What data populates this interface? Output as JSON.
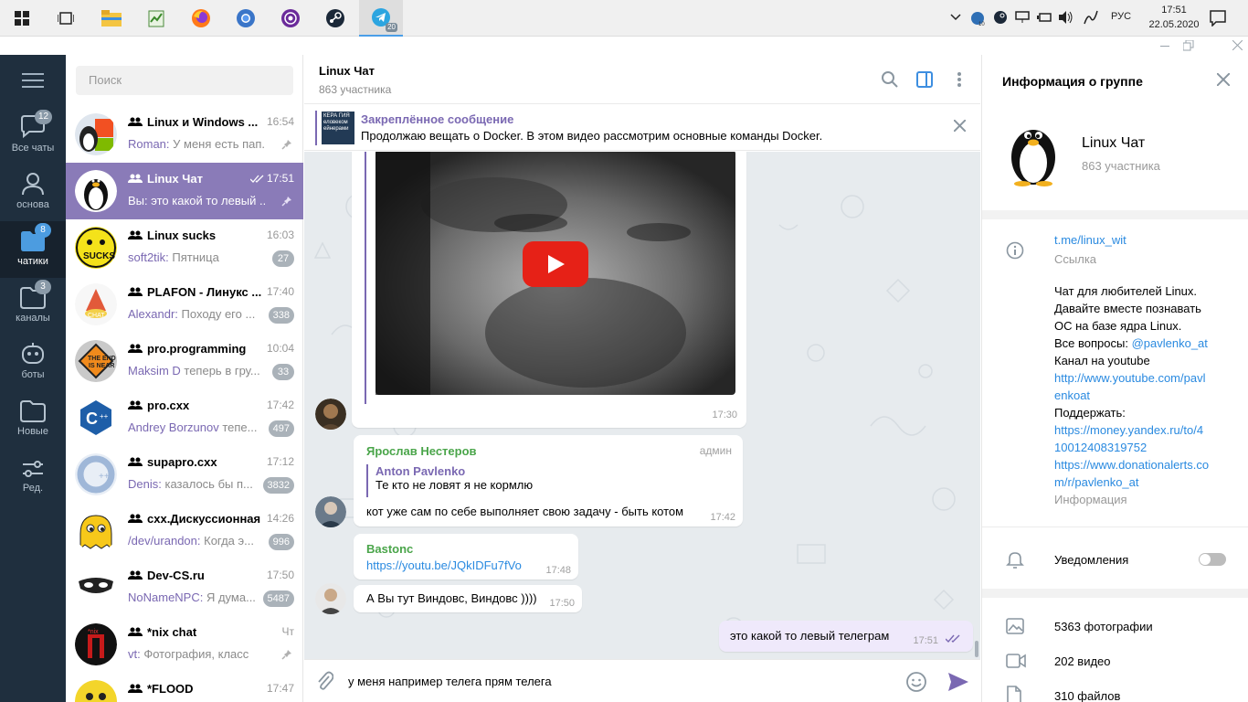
{
  "taskbar": {
    "lang": "РУС",
    "time": "17:51",
    "date": "22.05.2020",
    "telegram_badge": "20",
    "apps": [
      "windows-start",
      "task-view",
      "file-explorer",
      "notepad",
      "firefox",
      "chromium",
      "tor-browser",
      "steam",
      "telegram"
    ]
  },
  "rail": {
    "items": [
      {
        "label": "Все чаты",
        "badge": "12"
      },
      {
        "label": "основа",
        "badge": ""
      },
      {
        "label": "чатики",
        "badge": "8"
      },
      {
        "label": "каналы",
        "badge": "3"
      },
      {
        "label": "боты",
        "badge": ""
      },
      {
        "label": "Новые",
        "badge": ""
      },
      {
        "label": "Ред.",
        "badge": ""
      }
    ]
  },
  "chatlist": {
    "search_placeholder": "Поиск",
    "chats": [
      {
        "name": "Linux и Windows ...",
        "time": "16:54",
        "sender": "Roman:",
        "preview": " У меня есть пап...",
        "count": "",
        "pinned": true
      },
      {
        "name": "Linux Чат",
        "time": "17:51",
        "sender": "Вы:",
        "preview": " это какой то левый ...",
        "count": "",
        "pinned": true
      },
      {
        "name": "Linux sucks",
        "time": "16:03",
        "sender": "soft2tik:",
        "preview": " Пятница",
        "count": "27",
        "pinned": false
      },
      {
        "name": "PLAFON - Линукс ...",
        "time": "17:40",
        "sender": "Alexandr:",
        "preview": " Походу его ...",
        "count": "338",
        "pinned": false
      },
      {
        "name": "pro.programming",
        "time": "10:04",
        "sender": "Maksim D",
        "preview": " теперь в гру...",
        "count": "33",
        "pinned": false
      },
      {
        "name": "pro.cxx",
        "time": "17:42",
        "sender": "Andrey Borzunov",
        "preview": " тепе...",
        "count": "497",
        "pinned": false
      },
      {
        "name": "supapro.cxx",
        "time": "17:12",
        "sender": "Denis:",
        "preview": " казалось бы п...",
        "count": "3832",
        "pinned": false
      },
      {
        "name": "cxx.Дискуссионная",
        "time": "14:26",
        "sender": "/dev/urandon:",
        "preview": " Когда э...",
        "count": "996",
        "pinned": false
      },
      {
        "name": "Dev-CS.ru",
        "time": "17:50",
        "sender": "NoNameNPC:",
        "preview": " Я дума...",
        "count": "5487",
        "pinned": false
      },
      {
        "name": "*nix chat",
        "time": "Чт",
        "sender": "vt:",
        "preview": " Фотография, класс",
        "count": "",
        "pinned": true
      },
      {
        "name": "*FLOOD",
        "time": "17:47",
        "sender": "",
        "preview": "",
        "count": "",
        "pinned": false
      }
    ]
  },
  "chat": {
    "title": "Linux Чат",
    "subtitle": "863 участника",
    "pinned_label": "Закреплённое сообщение",
    "pinned_text": "Продолжаю вещать о Docker. В этом видео рассмотрим основные команды Docker.",
    "pinned_thumb_text": "КЕРА ГИЯ еловеком ейнерами",
    "video_time": "17:30",
    "msg1_author": "Ярослав Нестеров",
    "msg1_role": "админ",
    "msg1_reply_name": "Anton Pavlenko",
    "msg1_reply_text": "Те кто не ловят я не кормлю",
    "msg1_text": "кот уже сам по себе выполняет свою задачу - быть котом",
    "msg1_time": "17:42",
    "msg2_author": "Bastonc",
    "msg2_link": "https://youtu.be/JQkIDFu7fVo",
    "msg2_time": "17:48",
    "msg3_text": "А Вы тут Виндовс, Виндовс ))))",
    "msg3_time": "17:50",
    "out_text": "это какой то левый телеграм",
    "out_time": "17:51",
    "composer_text": "у меня например телега прям телега"
  },
  "info": {
    "title": "Информация о группе",
    "name": "Linux Чат",
    "count": "863 участника",
    "link": "t.me/linux_wit",
    "link_label": "Ссылка",
    "desc": [
      {
        "t": "Чат для любителей Linux.",
        "link": false
      },
      {
        "t": "Давайте вместе познавать",
        "link": false
      },
      {
        "t": "ОС на базе ядра Linux.",
        "link": false
      }
    ],
    "desc_q_prefix": "Все вопросы: ",
    "desc_q_link": "@pavlenko_at",
    "desc2": [
      {
        "t": "Канал на youtube",
        "link": false
      },
      {
        "t": "http://www.youtube.com/pavl",
        "link": true
      },
      {
        "t": "enkoat",
        "link": true
      },
      {
        "t": "Поддержать:",
        "link": false
      },
      {
        "t": "https://money.yandex.ru/to/4",
        "link": true
      },
      {
        "t": "10012408319752",
        "link": true
      },
      {
        "t": "https://www.donationalerts.co",
        "link": true
      },
      {
        "t": "m/r/pavlenko_at",
        "link": true
      }
    ],
    "desc_label": "Информация",
    "notifications": "Уведомления",
    "notifications_on": false,
    "photos": "5363 фотографии",
    "videos": "202 видео",
    "files": "310 файлов"
  },
  "colors": {
    "accent": "#7a68b2",
    "rail": "#1f2f3e",
    "link": "#2a8ae0",
    "green_author": "#4aa54a"
  }
}
